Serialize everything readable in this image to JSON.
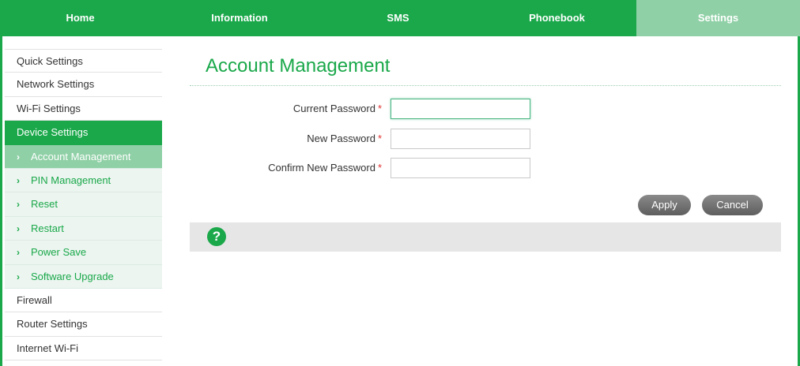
{
  "nav": {
    "tabs": [
      {
        "label": "Home"
      },
      {
        "label": "Information"
      },
      {
        "label": "SMS"
      },
      {
        "label": "Phonebook"
      },
      {
        "label": "Settings"
      }
    ],
    "active": "Settings"
  },
  "sidebar": {
    "items": [
      {
        "label": "Quick Settings"
      },
      {
        "label": "Network Settings"
      },
      {
        "label": "Wi-Fi Settings"
      },
      {
        "label": "Device Settings"
      },
      {
        "label": "Account Management"
      },
      {
        "label": "PIN Management"
      },
      {
        "label": "Reset"
      },
      {
        "label": "Restart"
      },
      {
        "label": "Power Save"
      },
      {
        "label": "Software Upgrade"
      },
      {
        "label": "Firewall"
      },
      {
        "label": "Router Settings"
      },
      {
        "label": "Internet Wi-Fi"
      }
    ],
    "chevron": "›"
  },
  "main": {
    "title": "Account Management",
    "fields": [
      {
        "label": "Current Password",
        "required_mark": "*",
        "value": ""
      },
      {
        "label": "New Password",
        "required_mark": "*",
        "value": ""
      },
      {
        "label": "Confirm New Password",
        "required_mark": "*",
        "value": ""
      }
    ],
    "apply_label": "Apply",
    "cancel_label": "Cancel",
    "help_icon": "?"
  },
  "colors": {
    "brand_green": "#1aa84a",
    "active_tab": "#8fd0a6",
    "required": "#e23030"
  }
}
